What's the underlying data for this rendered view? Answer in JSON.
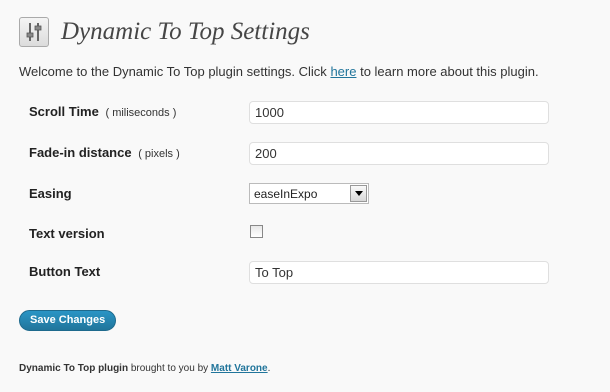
{
  "header": {
    "title": "Dynamic To Top Settings",
    "icon": "settings-sliders-icon"
  },
  "intro": {
    "before": "Welcome to the Dynamic To Top plugin settings. Click ",
    "link": "here",
    "after": " to learn more about this plugin."
  },
  "form": {
    "scroll_time": {
      "label": "Scroll Time",
      "unit": "( miliseconds )",
      "value": "1000"
    },
    "fade_in": {
      "label": "Fade-in distance",
      "unit": "( pixels )",
      "value": "200"
    },
    "easing": {
      "label": "Easing",
      "value": "easeInExpo"
    },
    "text_version": {
      "label": "Text version",
      "checked": false
    },
    "button_text": {
      "label": "Button Text",
      "value": "To Top"
    }
  },
  "save_label": "Save Changes",
  "footer": {
    "plugin": "Dynamic To Top plugin",
    "middle": " brought to you by ",
    "author": "Matt Varone",
    "end": "."
  },
  "colors": {
    "link": "#21759b",
    "button": "#21759b",
    "background": "#f9f9f9"
  }
}
